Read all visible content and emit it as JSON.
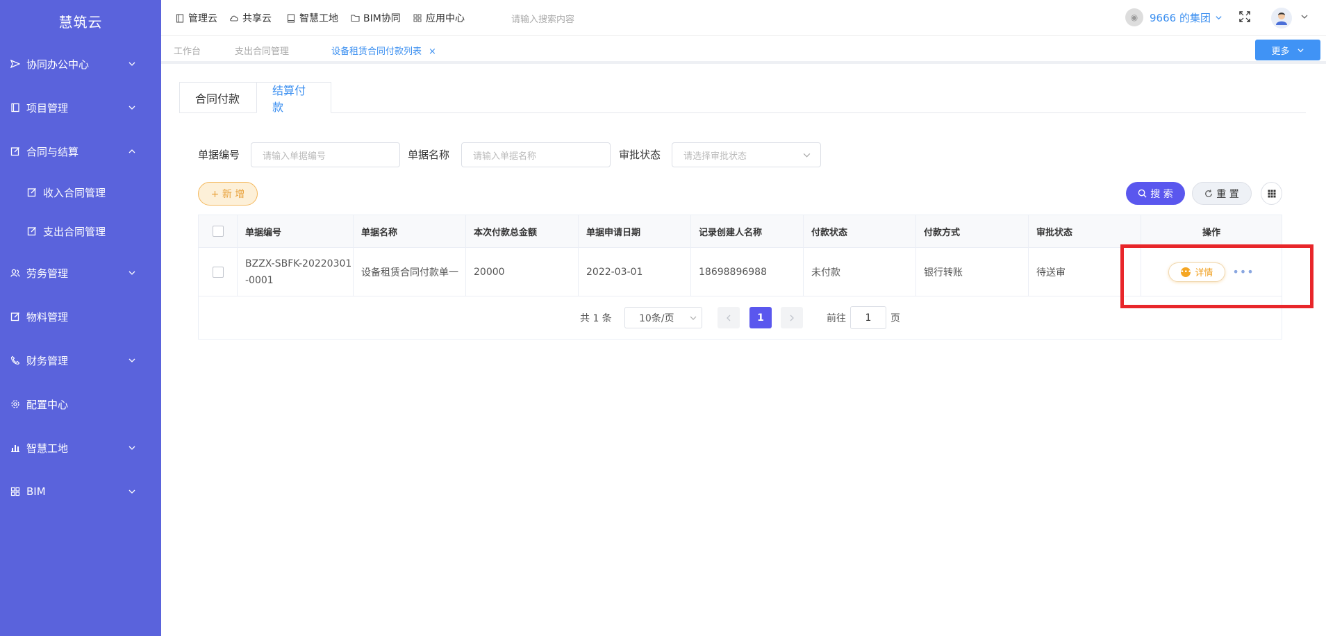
{
  "app": {
    "logo": "慧筑云"
  },
  "sidebar": {
    "items": [
      {
        "label": "协同办公中心",
        "icon": "send-icon",
        "expandable": true
      },
      {
        "label": "项目管理",
        "icon": "book-icon",
        "expandable": true
      },
      {
        "label": "合同与结算",
        "icon": "edit-icon",
        "expandable": true,
        "expanded": true
      },
      {
        "label": "收入合同管理",
        "icon": "edit-icon"
      },
      {
        "label": "支出合同管理",
        "icon": "edit-icon"
      },
      {
        "label": "劳务管理",
        "icon": "users-icon",
        "expandable": true
      },
      {
        "label": "物料管理",
        "icon": "edit-icon"
      },
      {
        "label": "财务管理",
        "icon": "phone-icon",
        "expandable": true
      },
      {
        "label": "配置中心",
        "icon": "gear-icon"
      },
      {
        "label": "智慧工地",
        "icon": "chart-icon",
        "expandable": true
      },
      {
        "label": "BIM",
        "icon": "grid-icon",
        "expandable": true
      }
    ]
  },
  "topnav": {
    "items": [
      {
        "label": "管理云",
        "icon": "document-icon"
      },
      {
        "label": "共享云",
        "icon": "cloud-icon"
      },
      {
        "label": "智慧工地",
        "icon": "book-icon"
      },
      {
        "label": "BIM协同",
        "icon": "folder-icon"
      },
      {
        "label": "应用中心",
        "icon": "grid-icon"
      }
    ],
    "search_placeholder": "请输入搜索内容",
    "group": "9666 的集团"
  },
  "tabs": {
    "items": [
      {
        "label": "工作台"
      },
      {
        "label": "支出合同管理"
      },
      {
        "label": "设备租赁合同付款列表",
        "active": true
      }
    ],
    "close": "×",
    "more": "更多"
  },
  "subtabs": [
    "合同付款",
    "结算付款"
  ],
  "filters": {
    "doc_no_label": "单据编号",
    "doc_no_placeholder": "请输入单据编号",
    "doc_name_label": "单据名称",
    "doc_name_placeholder": "请输入单据名称",
    "status_label": "审批状态",
    "status_placeholder": "请选择审批状态"
  },
  "actions": {
    "add": "+ 新 增",
    "search": "搜 索",
    "reset": "重 置"
  },
  "table": {
    "headers": [
      "单据编号",
      "单据名称",
      "本次付款总金额",
      "单据申请日期",
      "记录创建人名称",
      "付款状态",
      "付款方式",
      "审批状态",
      "操作"
    ],
    "rows": [
      {
        "doc_no": "BZZX-SBFK-20220301-0001",
        "doc_name": "设备租赁合同付款单一",
        "amount": "20000",
        "date": "2022-03-01",
        "creator": "18698896988",
        "pay_status": "未付款",
        "pay_method": "银行转账",
        "approval": "待送审",
        "detail": "详情"
      }
    ]
  },
  "pagination": {
    "total": "共 1 条",
    "page_size": "10条/页",
    "current": "1",
    "goto_label": "前往",
    "goto_value": "1",
    "page_suffix": "页"
  },
  "colors": {
    "sidebar": "#5a63dc",
    "accent": "#3b8ff0",
    "primary_button": "#5a57ee",
    "highlight": "#e8262a"
  }
}
